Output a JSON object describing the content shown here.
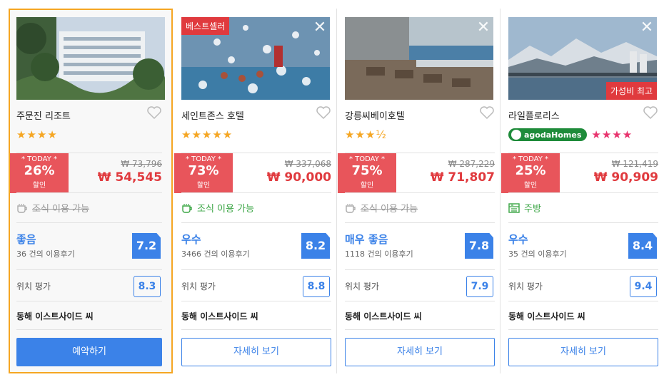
{
  "hotels": [
    {
      "name": "주문진 리조트",
      "stars": "★★★★",
      "today_label": "* TODAY *",
      "discount": "26%",
      "discount_label": "할인",
      "original_price": "₩ 73,796",
      "sale_price": "₩ 54,545",
      "amenity": "조식 이용 가능",
      "grade": "좋음",
      "reviews": "36 건의 이용후기",
      "score": "7.2",
      "location_label": "위치 평가",
      "location_score": "8.3",
      "area": "동해 이스트사이드 씨",
      "button": "예약하기"
    },
    {
      "name": "세인트존스 호텔",
      "badge": "베스트셀러",
      "stars": "★★★★★",
      "today_label": "* TODAY *",
      "discount": "73%",
      "discount_label": "할인",
      "original_price": "₩ 337,068",
      "sale_price": "₩ 90,000",
      "amenity": "조식 이용 가능",
      "grade": "우수",
      "reviews": "3466 건의 이용후기",
      "score": "8.2",
      "location_label": "위치 평가",
      "location_score": "8.8",
      "area": "동해 이스트사이드 씨",
      "button": "자세히 보기"
    },
    {
      "name": "강릉씨베이호텔",
      "stars": "★★★½",
      "today_label": "* TODAY *",
      "discount": "75%",
      "discount_label": "할인",
      "original_price": "₩ 287,229",
      "sale_price": "₩ 71,807",
      "amenity": "조식 이용 가능",
      "grade": "매우 좋음",
      "reviews": "1118 건의 이용후기",
      "score": "7.8",
      "location_label": "위치 평가",
      "location_score": "7.9",
      "area": "동해 이스트사이드 씨",
      "button": "자세히 보기"
    },
    {
      "name": "라일플로리스",
      "badge": "가성비 최고",
      "agoda": "agodaHomes",
      "stars": "★★★★",
      "today_label": "* TODAY *",
      "discount": "25%",
      "discount_label": "할인",
      "original_price": "₩ 121,419",
      "sale_price": "₩ 90,909",
      "amenity": "주방",
      "grade": "우수",
      "reviews": "35 건의 이용후기",
      "score": "8.4",
      "location_label": "위치 평가",
      "location_score": "9.4",
      "area": "동해 이스트사이드 씨",
      "button": "자세히 보기"
    }
  ],
  "close_glyph": "✕"
}
